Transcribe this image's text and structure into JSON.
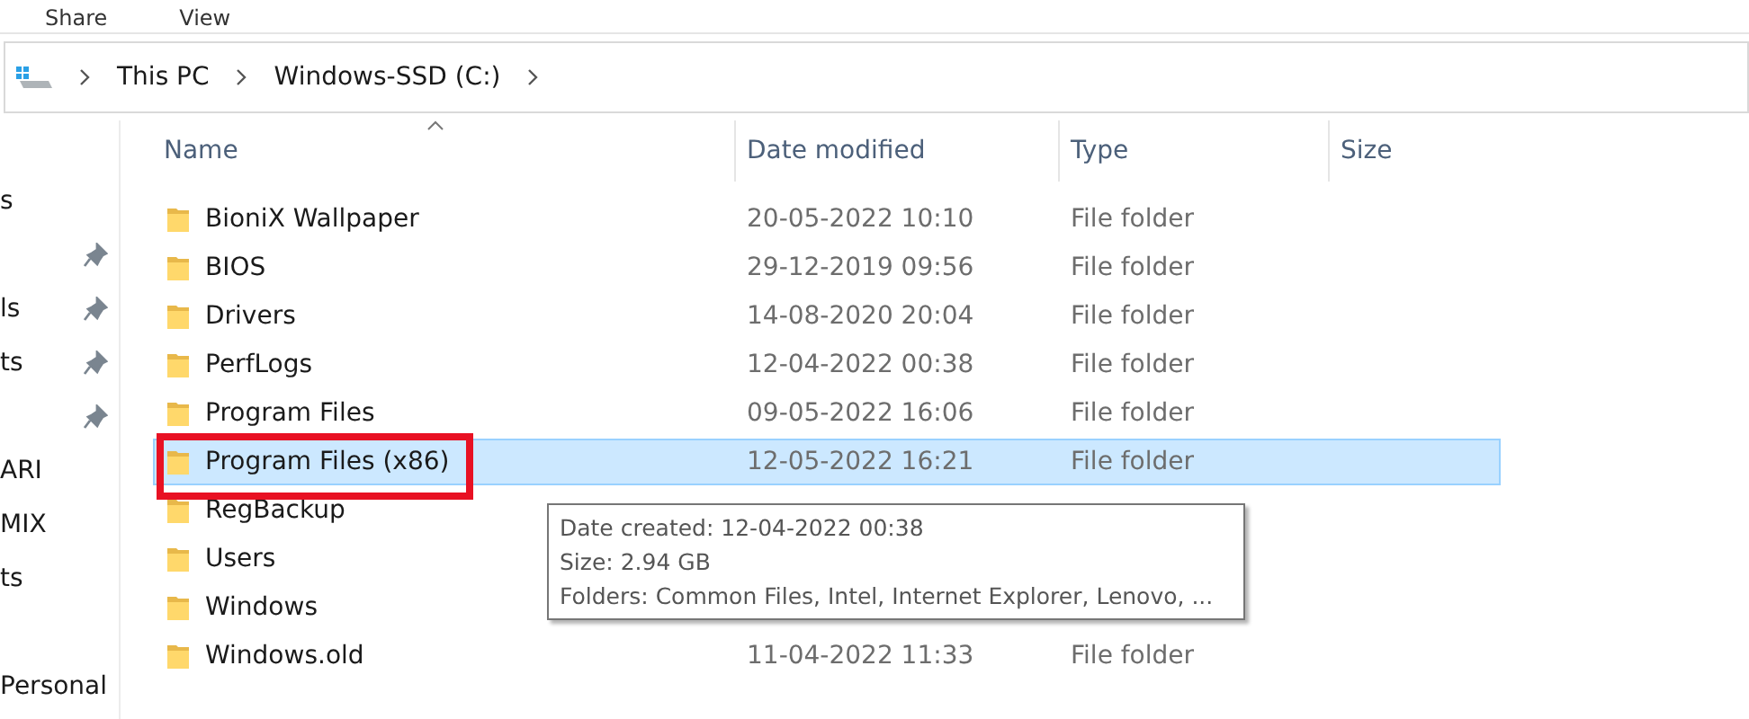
{
  "ribbon_tabs": [
    "Share",
    "View"
  ],
  "breadcrumb": [
    "This PC",
    "Windows-SSD (C:)"
  ],
  "sidebar": [
    {
      "label": "s",
      "pinned": false
    },
    {
      "pinned": true
    },
    {
      "label": "ls",
      "pinned": true
    },
    {
      "label": "ts",
      "pinned": true
    },
    {
      "pinned": true
    },
    {
      "label": "ARI",
      "pinned": false
    },
    {
      "label": "MIX",
      "pinned": false
    },
    {
      "label": "ts",
      "pinned": false
    },
    {
      "pinned": false
    },
    {
      "label": "Personal",
      "pinned": false
    }
  ],
  "columns": [
    "Name",
    "Date modified",
    "Type",
    "Size"
  ],
  "rows": [
    {
      "name": "BioniX Wallpaper",
      "date": "20-05-2022 10:10",
      "type": "File folder",
      "selected": false
    },
    {
      "name": "BIOS",
      "date": "29-12-2019 09:56",
      "type": "File folder",
      "selected": false
    },
    {
      "name": "Drivers",
      "date": "14-08-2020 20:04",
      "type": "File folder",
      "selected": false
    },
    {
      "name": "PerfLogs",
      "date": "12-04-2022 00:38",
      "type": "File folder",
      "selected": false
    },
    {
      "name": "Program Files",
      "date": "09-05-2022 16:06",
      "type": "File folder",
      "selected": false
    },
    {
      "name": "Program Files (x86)",
      "date": "12-05-2022 16:21",
      "type": "File folder",
      "selected": true,
      "highlighted": true
    },
    {
      "name": "RegBackup",
      "selected": false
    },
    {
      "name": "Users",
      "selected": false
    },
    {
      "name": "Windows",
      "selected": false
    },
    {
      "name": "Windows.old",
      "date": "11-04-2022 11:33",
      "type": "File folder",
      "selected": false
    }
  ],
  "tooltip": [
    "Date created: 12-04-2022 00:38",
    "Size: 2.94 GB",
    "Folders: Common Files, Intel, Internet Explorer, Lenovo, ..."
  ]
}
